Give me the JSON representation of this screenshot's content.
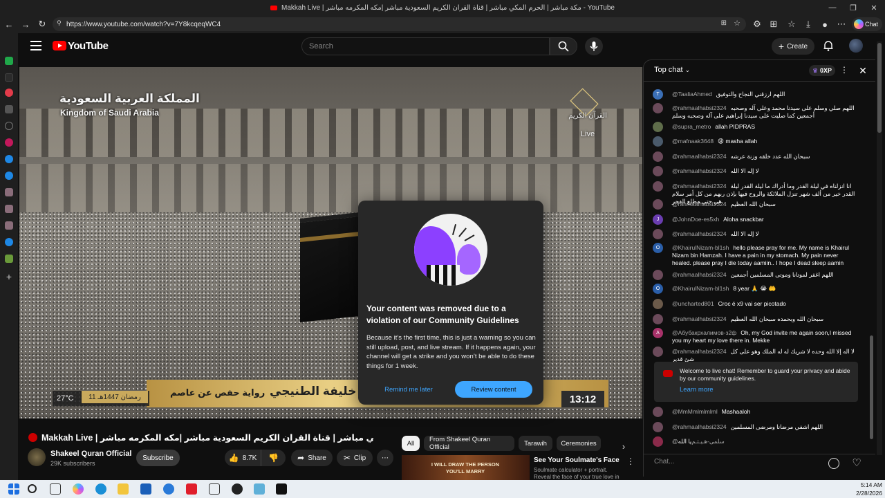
{
  "browser": {
    "window_title": "Makkah Live | مكة مباشر | الحرم المكي مباشر | قناة القران الكريم السعودية مباشر |مكه المكرمه مباشر - YouTube",
    "url": "https://www.youtube.com/watch?v=7Y8kcqeqWC4",
    "chat_button": "Chat"
  },
  "youtube": {
    "logo": "YouTube",
    "search_placeholder": "Search",
    "create_label": "Create"
  },
  "video_overlay": {
    "ksa_arabic": "المملكة العربية السعودية",
    "ksa_english": "Kingdom of Saudi Arabia",
    "channel_logo_text": "القرآن الكريم",
    "live": "Live",
    "temperature": "27°C",
    "date": "11 رمضان 1447هـ",
    "riwaya": "رواية حفص عن عاصم",
    "reader": "القارئ : خليفة الطنيجي",
    "time": "13:12"
  },
  "modal": {
    "title": "Your content was removed due to a violation of our Community Guidelines",
    "body": "Because it’s the first time, this is just a warning so you can still upload, post, and live stream. If it happens again, your channel will get a strike and you won’t be able to do these things for 1 week.",
    "remind_label": "Remind me later",
    "review_label": "Review content"
  },
  "video_info": {
    "title": "Makkah Live | مكة مباشر | الحرم المكي مباشر | قناة القران الكريم السعودية مباشر |مكه المكرمه مباشر",
    "channel": "Shakeel Quran Official",
    "subscribers": "29K subscribers",
    "subscribe_label": "Subscribe",
    "likes": "8.7K",
    "share_label": "Share",
    "clip_label": "Clip"
  },
  "chips": [
    "All",
    "From Shakeel Quran Official",
    "Tarawih",
    "Ceremonies"
  ],
  "recommendation": {
    "thumb_text": "I WILL DRAW THE PERSON YOU'LL MARRY",
    "title": "See Your Soulmate's Face",
    "desc": "Soulmate calculator + portrait. Reveal the face of your true love in"
  },
  "chat": {
    "header": "Top chat",
    "xp": "0XP",
    "messages": [
      {
        "author": "@TaaliaAhmed",
        "text": "اللهم ارزقني النجاح والتوفيق",
        "avatar": "T",
        "color": "#3b6fb6"
      },
      {
        "author": "@rahmaalhabsi2324",
        "text": "اللهم صلي وسلم على سيدنا محمد وعلى آله وصحبه أجمعين كما صليت على سيدنا إبراهيم على آله وصحبه وسلم",
        "avatar": "",
        "color": "#6b4a5a"
      },
      {
        "author": "@supra_metro",
        "text": "allah PIDPRAS",
        "avatar": "",
        "color": "#5f6d4a"
      },
      {
        "author": "@mafnaak3648",
        "text": "😩 masha allah",
        "avatar": "",
        "color": "#4a5a6b"
      },
      {
        "author": "@rahmaalhabsi2324",
        "text": "سبحان الله عدد خلقه وزنة عرشه",
        "avatar": "",
        "color": "#6b4a5a"
      },
      {
        "author": "@rahmaalhabsi2324",
        "text": "لا إله الا الله",
        "avatar": "",
        "color": "#6b4a5a"
      },
      {
        "author": "@rahmaalhabsi2324",
        "text": "انا انزلناه في ليلة القدر وما أدراك ما ليلة القدر ليلة القدر خير من ألف شهر تنزل الملائكة والروح فيها بإذن ربهم من كل أمر سلام هي حتى مطلع الفجر",
        "avatar": "",
        "color": "#6b4a5a"
      },
      {
        "author": "@rahmaalhabsi2324",
        "text": "سبحان الله العظيم",
        "avatar": "",
        "color": "#6b4a5a"
      },
      {
        "author": "@JohnDoe-es5xh",
        "text": "Aloha snackbar",
        "avatar": "J",
        "color": "#6a3db0"
      },
      {
        "author": "@rahmaalhabsi2324",
        "text": "لا إله الا الله",
        "avatar": "",
        "color": "#6b4a5a"
      },
      {
        "author": "@KhairulNizam-bl1sh",
        "text": "hello please pray for me. My name is Khairul Nizam bin Hamzah. I have a pain in my stomach. My pain never healed. please pray I die today aamiin.. I hope I dead sleep aamin",
        "avatar": "O",
        "color": "#2a5ea8"
      },
      {
        "author": "@rahmaalhabsi2324",
        "text": "اللهم اغفر لموتانا وموتى المسلمين أجمعين",
        "avatar": "",
        "color": "#6b4a5a"
      },
      {
        "author": "@KhairulNizam-bl1sh",
        "text": "8 year 🙏 😭 🤲",
        "avatar": "O",
        "color": "#2a5ea8"
      },
      {
        "author": "@uncharted801",
        "text": "Croc é x9 vai ser picotado",
        "avatar": "",
        "color": "#6b5a4a"
      },
      {
        "author": "@rahmaalhabsi2324",
        "text": "سبحان الله وبحمده سبحان الله العظيم",
        "avatar": "",
        "color": "#6b4a5a"
      },
      {
        "author": "@Абубакрхалимов-з2ф",
        "text": "Oh, my God invite me again soon,I missed you my heart my love there in. Mekke",
        "avatar": "A",
        "color": "#a8326a"
      },
      {
        "author": "@rahmaalhabsi2324",
        "text": "لا اله إلا الله وحده لا شريك له له الملك وهو على كل شئ قدير",
        "avatar": "",
        "color": "#6b4a5a"
      },
      {
        "author": "@MmMmlmlmlml",
        "text": "Mashaaloh",
        "avatar": "",
        "color": "#6b4a5a"
      },
      {
        "author": "@rahmaalhabsi2324",
        "text": "اللهم اشفي مرضانا ومرضى المسلمين",
        "avatar": "",
        "color": "#6b4a5a"
      },
      {
        "author": "@سلمی-ﻫـﯿـﺜـﻢ",
        "text": "يا الله",
        "avatar": "",
        "color": "#8a2a4a"
      }
    ],
    "welcome_text": "Welcome to live chat! Remember to guard your privacy and abide by our community guidelines.",
    "learn_more": "Learn more",
    "input_placeholder": "Chat..."
  },
  "taskbar": {
    "time": "5:14 AM",
    "date": "2/28/2026"
  }
}
